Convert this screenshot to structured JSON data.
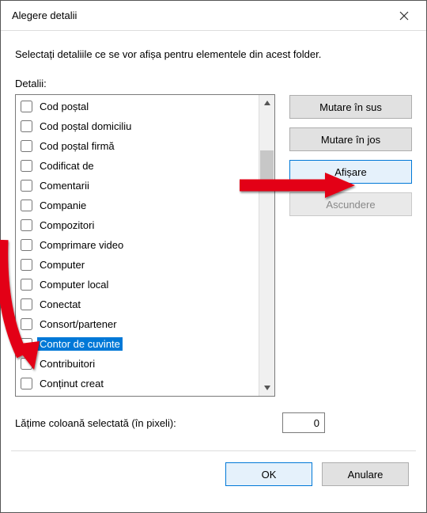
{
  "window": {
    "title": "Alegere detalii"
  },
  "instructions": "Selectați detaliile ce se vor afișa pentru elementele din acest folder.",
  "details": {
    "label": "Detalii:",
    "items": [
      {
        "label": "Cod poștal",
        "checked": false,
        "selected": false
      },
      {
        "label": "Cod poștal domiciliu",
        "checked": false,
        "selected": false
      },
      {
        "label": "Cod poștal firmă",
        "checked": false,
        "selected": false
      },
      {
        "label": "Codificat de",
        "checked": false,
        "selected": false
      },
      {
        "label": "Comentarii",
        "checked": false,
        "selected": false
      },
      {
        "label": "Companie",
        "checked": false,
        "selected": false
      },
      {
        "label": "Compozitori",
        "checked": false,
        "selected": false
      },
      {
        "label": "Comprimare video",
        "checked": false,
        "selected": false
      },
      {
        "label": "Computer",
        "checked": false,
        "selected": false
      },
      {
        "label": "Computer local",
        "checked": false,
        "selected": false
      },
      {
        "label": "Conectat",
        "checked": false,
        "selected": false
      },
      {
        "label": "Consort/partener",
        "checked": false,
        "selected": false
      },
      {
        "label": "Contor de cuvinte",
        "checked": false,
        "selected": true
      },
      {
        "label": "Contribuitori",
        "checked": false,
        "selected": false
      },
      {
        "label": "Conținut creat",
        "checked": false,
        "selected": false
      }
    ]
  },
  "buttons": {
    "move_up": "Mutare în sus",
    "move_down": "Mutare în jos",
    "show": "Afișare",
    "hide": "Ascundere",
    "ok": "OK",
    "cancel": "Anulare"
  },
  "width_field": {
    "label": "Lățime coloană selectată (în pixeli):",
    "value": "0"
  }
}
